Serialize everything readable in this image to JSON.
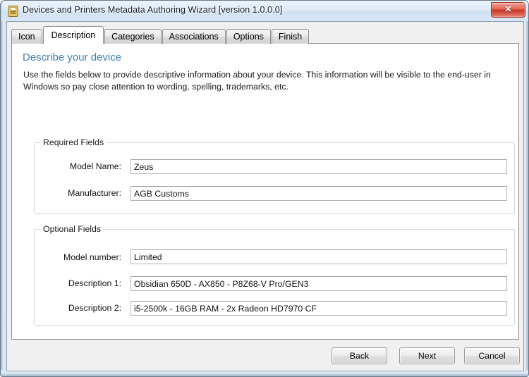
{
  "window": {
    "title": "Devices and Printers Metadata Authoring Wizard [version 1.0.0.0]",
    "icon": "wizard-document-icon",
    "close_label": "✕",
    "titlebar_color": "#d7e6f5",
    "close_color": "#c63323"
  },
  "tabs": [
    {
      "label": "Icon",
      "selected": false
    },
    {
      "label": "Description",
      "selected": true
    },
    {
      "label": "Categories",
      "selected": false
    },
    {
      "label": "Associations",
      "selected": false
    },
    {
      "label": "Options",
      "selected": false
    },
    {
      "label": "Finish",
      "selected": false
    }
  ],
  "page": {
    "title": "Describe your device",
    "title_color": "#3c7fb1",
    "description": "Use the fields below to provide descriptive information about your device. This information will be visible to the end-user in Windows so pay close attention to wording, spelling, trademarks, etc."
  },
  "required_group": {
    "title": "Required Fields",
    "fields": [
      {
        "label": "Model Name:",
        "value": "Zeus",
        "placeholder": ""
      },
      {
        "label": "Manufacturer:",
        "value": "AGB Customs",
        "placeholder": ""
      }
    ]
  },
  "optional_group": {
    "title": "Optional Fields",
    "fields": [
      {
        "label": "Model number:",
        "value": "Limited",
        "placeholder": ""
      },
      {
        "label": "Description 1:",
        "value": "Obsidian 650D - AX850 - P8Z68-V Pro/GEN3",
        "placeholder": ""
      },
      {
        "label": "Description 2:",
        "value": "i5-2500k - 16GB RAM - 2x Radeon HD7970 CF",
        "placeholder": ""
      }
    ]
  },
  "footer": {
    "back_label": "Back",
    "next_label": "Next",
    "cancel_label": "Cancel"
  }
}
